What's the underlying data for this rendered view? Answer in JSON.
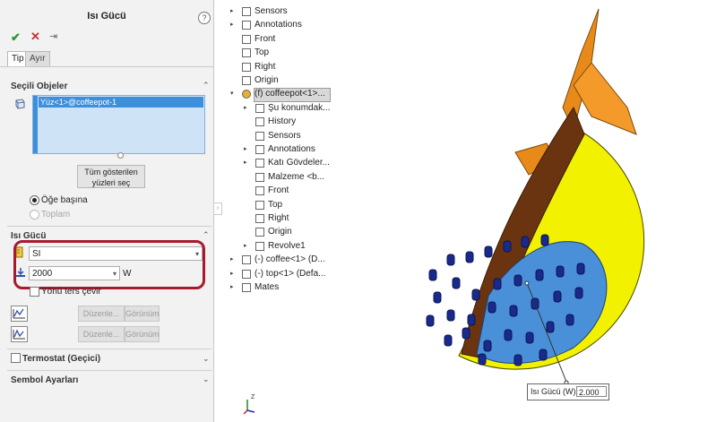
{
  "panel": {
    "title": "Isı Gücü",
    "help_label": "?",
    "ok_label": "✔",
    "cancel_label": "✕",
    "pin_label": "⇥",
    "tabs": [
      {
        "label": "Tip",
        "active": true
      },
      {
        "label": "Ayır",
        "active": false
      }
    ],
    "selected_objects": {
      "header": "Seçili Objeler",
      "items": [
        "Yüz<1>@coffeepot-1"
      ],
      "show_faces_button_line1": "Tüm gösterilen",
      "show_faces_button_line2": "yüzleri seç",
      "radio_per_item": "Öğe başına",
      "radio_total": "Toplam"
    },
    "heat_power": {
      "header": "Isı Gücü",
      "unit_system": "SI",
      "value": "2000",
      "unit": "W",
      "reverse_direction": "Yönü ters çevir",
      "edit_button": "Düzenle...",
      "view_button": "Görünüm",
      "edit_button_2": "Düzenle...",
      "view_button_2": "Görünüm"
    },
    "thermostat": {
      "label": "Termostat (Geçici)"
    },
    "symbol_settings": {
      "header": "Sembol Ayarları"
    }
  },
  "tree": {
    "items": [
      {
        "label": "Sensors",
        "indent": 0,
        "arrow": "▸"
      },
      {
        "label": "Annotations",
        "indent": 0,
        "arrow": "▸"
      },
      {
        "label": "Front",
        "indent": 0,
        "arrow": ""
      },
      {
        "label": "Top",
        "indent": 0,
        "arrow": ""
      },
      {
        "label": "Right",
        "indent": 0,
        "arrow": ""
      },
      {
        "label": "Origin",
        "indent": 0,
        "arrow": ""
      },
      {
        "label": "(f) coffeepot<1>...",
        "indent": 0,
        "arrow": "▾",
        "selected": true
      },
      {
        "label": "Şu konumdak...",
        "indent": 1,
        "arrow": "▸"
      },
      {
        "label": "History",
        "indent": 1,
        "arrow": ""
      },
      {
        "label": "Sensors",
        "indent": 1,
        "arrow": ""
      },
      {
        "label": "Annotations",
        "indent": 1,
        "arrow": "▸"
      },
      {
        "label": "Katı Gövdeler...",
        "indent": 1,
        "arrow": "▸"
      },
      {
        "label": "Malzeme <b...",
        "indent": 1,
        "arrow": ""
      },
      {
        "label": "Front",
        "indent": 1,
        "arrow": ""
      },
      {
        "label": "Top",
        "indent": 1,
        "arrow": ""
      },
      {
        "label": "Right",
        "indent": 1,
        "arrow": ""
      },
      {
        "label": "Origin",
        "indent": 1,
        "arrow": ""
      },
      {
        "label": "Revolve1",
        "indent": 1,
        "arrow": "▸"
      },
      {
        "label": "(-) coffee<1> (D...",
        "indent": 0,
        "arrow": "▸"
      },
      {
        "label": "(-) top<1> (Defa...",
        "indent": 0,
        "arrow": "▸"
      },
      {
        "label": "Mates",
        "indent": 0,
        "arrow": "▸"
      }
    ]
  },
  "viewport": {
    "callout_label": "Isı Gücü (W):",
    "callout_value": "2.000",
    "triad_label": "Z"
  },
  "colors": {
    "selection_blue": "#3d8fdc",
    "highlight_red": "#a61a2e",
    "model_yellow": "#f2f200",
    "inner_brown": "#6b3410",
    "face_blue": "#4a90d9",
    "arrow_navy": "#1a2a8c",
    "handle_orange": "#e78a1a"
  }
}
